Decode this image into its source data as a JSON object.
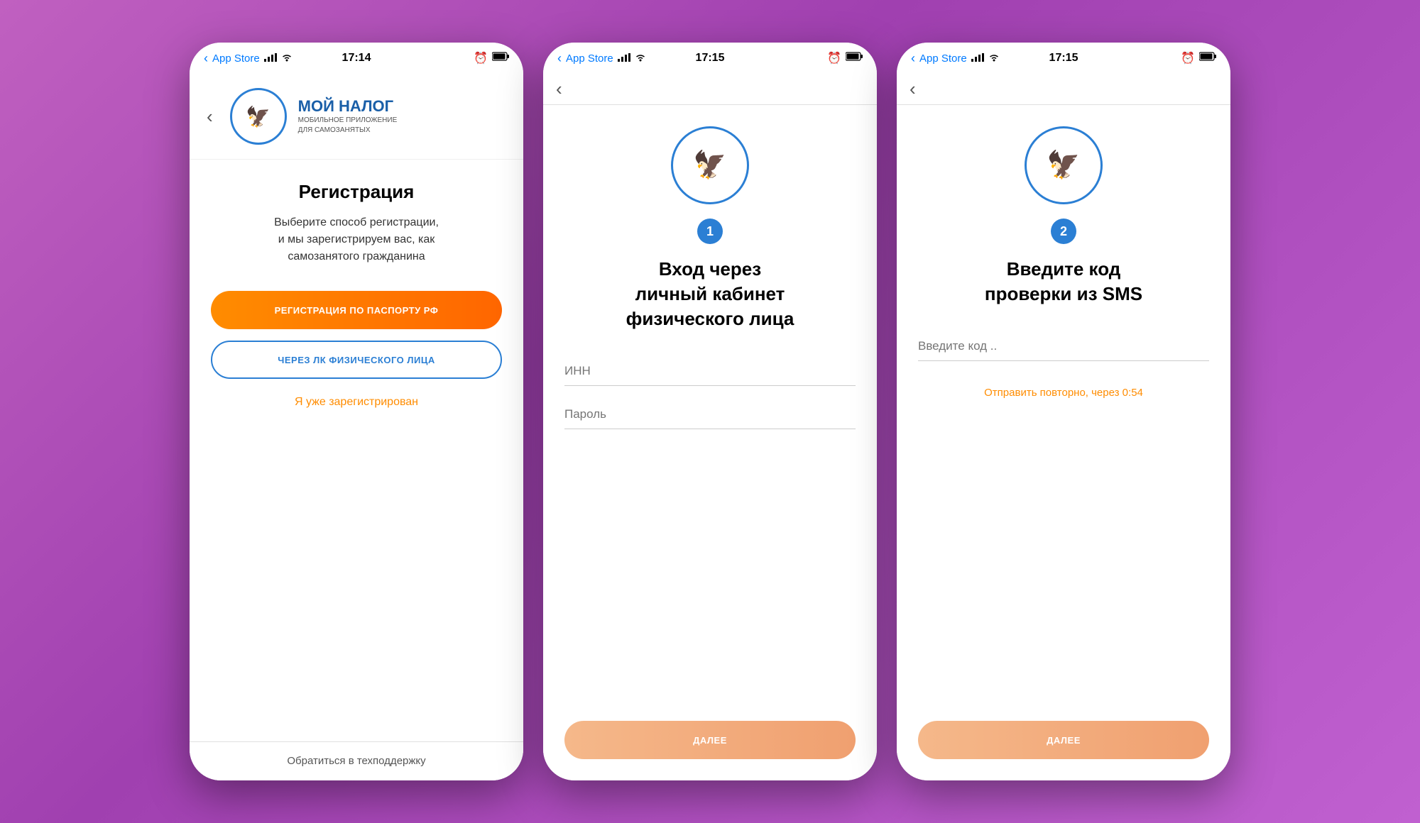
{
  "background_color": "#b04ac0",
  "phones": [
    {
      "id": "screen1",
      "status_bar": {
        "app_store": "App Store",
        "time": "17:14",
        "back_label": "‹"
      },
      "nav": {
        "back_icon": "‹"
      },
      "header": {
        "logo_alt": "ФНС Logo",
        "title": "МОЙ НАЛОГ",
        "subtitle_line1": "МОБИЛЬНОЕ ПРИЛОЖЕНИЕ",
        "subtitle_line2": "ДЛЯ САМОЗАНЯТЫХ"
      },
      "body": {
        "page_title": "Регистрация",
        "description": "Выберите способ регистрации,\nи мы зарегистрируем вас, как\nсамозанятого гражданина",
        "btn_passport": "РЕГИСТРАЦИЯ ПО ПАСПОРТУ РФ",
        "btn_lk": "ЧЕРЕЗ ЛК ФИЗИЧЕСКОГО ЛИЦА",
        "already_registered": "Я уже зарегистрирован"
      },
      "footer": {
        "support_link": "Обратиться в техподдержку"
      }
    },
    {
      "id": "screen2",
      "status_bar": {
        "app_store": "App Store",
        "time": "17:15",
        "back_label": "‹"
      },
      "nav": {
        "back_icon": "‹"
      },
      "body": {
        "step_number": "1",
        "title_line1": "Вход через",
        "title_line2": "личный кабинет",
        "title_line3": "физического лица",
        "inn_placeholder": "ИНН",
        "password_placeholder": "Пароль",
        "btn_next": "ДАЛЕЕ"
      }
    },
    {
      "id": "screen3",
      "status_bar": {
        "app_store": "App Store",
        "time": "17:15",
        "back_label": "‹"
      },
      "nav": {
        "back_icon": "‹"
      },
      "body": {
        "step_number": "2",
        "title_line1": "Введите код",
        "title_line2": "проверки из SMS",
        "code_placeholder": "Введите код ..",
        "resend_text": "Отправить повторно, через 0:54",
        "btn_next": "ДАЛЕЕ"
      }
    }
  ]
}
